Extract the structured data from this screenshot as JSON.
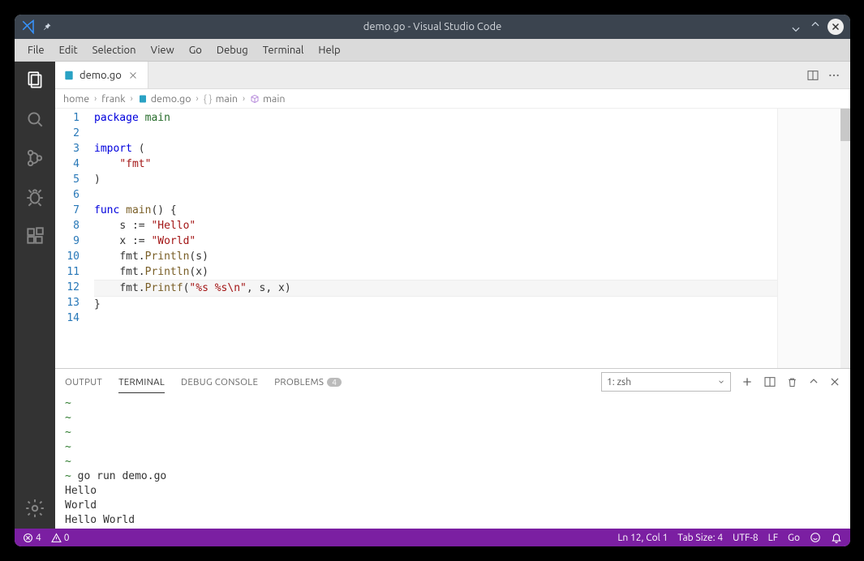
{
  "window": {
    "title": "demo.go - Visual Studio Code"
  },
  "menubar": [
    "File",
    "Edit",
    "Selection",
    "View",
    "Go",
    "Debug",
    "Terminal",
    "Help"
  ],
  "tab": {
    "filename": "demo.go"
  },
  "breadcrumbs": {
    "home": "home",
    "user": "frank",
    "file": "demo.go",
    "pkg": "main",
    "sym": "main"
  },
  "code": {
    "lines": [
      {
        "n": 1
      },
      {
        "n": 2
      },
      {
        "n": 3
      },
      {
        "n": 4
      },
      {
        "n": 5
      },
      {
        "n": 6
      },
      {
        "n": 7
      },
      {
        "n": 8
      },
      {
        "n": 9
      },
      {
        "n": 10
      },
      {
        "n": 11
      },
      {
        "n": 12
      },
      {
        "n": 13
      },
      {
        "n": 14
      }
    ],
    "text": {
      "l1_kw": "package",
      "l1_pkg": "main",
      "l3_kw": "import",
      "l3_paren": "(",
      "l4_str": "\"fmt\"",
      "l5_paren": ")",
      "l7_kw": "func",
      "l7_name": "main",
      "l7_rest": "() {",
      "l8_id": "s",
      "l8_op": ":=",
      "l8_str": "\"Hello\"",
      "l9_id": "x",
      "l9_op": ":=",
      "l9_str": "\"World\"",
      "l10_pkg": "fmt",
      "l10_fn": "Println",
      "l10_arg": "(s)",
      "l11_pkg": "fmt",
      "l11_fn": "Println",
      "l11_arg": "(x)",
      "l12_pkg": "fmt",
      "l12_fn": "Printf",
      "l12_open": "(",
      "l12_str": "\"%s %s\\n\"",
      "l12_rest": ", s, x)",
      "l13_brace": "}"
    }
  },
  "panel": {
    "tabs": {
      "output": "OUTPUT",
      "terminal": "TERMINAL",
      "debug": "DEBUG CONSOLE",
      "problems": "PROBLEMS",
      "problems_count": "4"
    },
    "term_select": "1: zsh"
  },
  "terminal": {
    "cmd_prompt": "~",
    "cmd": "go run demo.go",
    "out1": "Hello",
    "out2": "World",
    "out3": "Hello World"
  },
  "status": {
    "errors": "4",
    "warnings": "0",
    "cursor": "Ln 12, Col 1",
    "tabsize": "Tab Size: 4",
    "encoding": "UTF-8",
    "eol": "LF",
    "lang": "Go"
  }
}
